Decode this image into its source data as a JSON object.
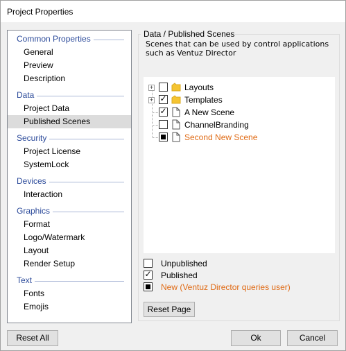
{
  "window": {
    "title": "Project Properties"
  },
  "nav": {
    "groups": [
      {
        "header": "Common Properties",
        "items": [
          "General",
          "Preview",
          "Description"
        ]
      },
      {
        "header": "Data",
        "items": [
          "Project Data",
          "Published Scenes"
        ]
      },
      {
        "header": "Security",
        "items": [
          "Project License",
          "SystemLock"
        ]
      },
      {
        "header": "Devices",
        "items": [
          "Interaction"
        ]
      },
      {
        "header": "Graphics",
        "items": [
          "Format",
          "Logo/Watermark",
          "Layout",
          "Render Setup"
        ]
      },
      {
        "header": "Text",
        "items": [
          "Fonts",
          "Emojis"
        ]
      }
    ],
    "selected": "Published Scenes"
  },
  "panel": {
    "title": "Data / Published Scenes",
    "description": "Scenes that can be used by control applications such as Ventuz Director"
  },
  "tree": {
    "items": [
      {
        "label": "Layouts",
        "icon": "folder-icon",
        "state": "unpublished",
        "expandable": true
      },
      {
        "label": "Templates",
        "icon": "folder-icon",
        "state": "published",
        "expandable": true
      },
      {
        "label": "A New Scene",
        "icon": "document-icon",
        "state": "published",
        "expandable": false
      },
      {
        "label": "ChannelBranding",
        "icon": "document-icon",
        "state": "unpublished",
        "expandable": false
      },
      {
        "label": "Second New Scene",
        "icon": "document-icon",
        "state": "new",
        "expandable": false,
        "highlight": true
      }
    ]
  },
  "legend": {
    "unpublished": "Unpublished",
    "published": "Published",
    "new": "New (Ventuz Director queries user)"
  },
  "buttons": {
    "reset_page": "Reset Page",
    "reset_all": "Reset All",
    "ok": "Ok",
    "cancel": "Cancel"
  },
  "colors": {
    "accent_orange": "#e06a14",
    "group_header_blue": "#2b4a9a",
    "folder_yellow": "#f5c431"
  }
}
